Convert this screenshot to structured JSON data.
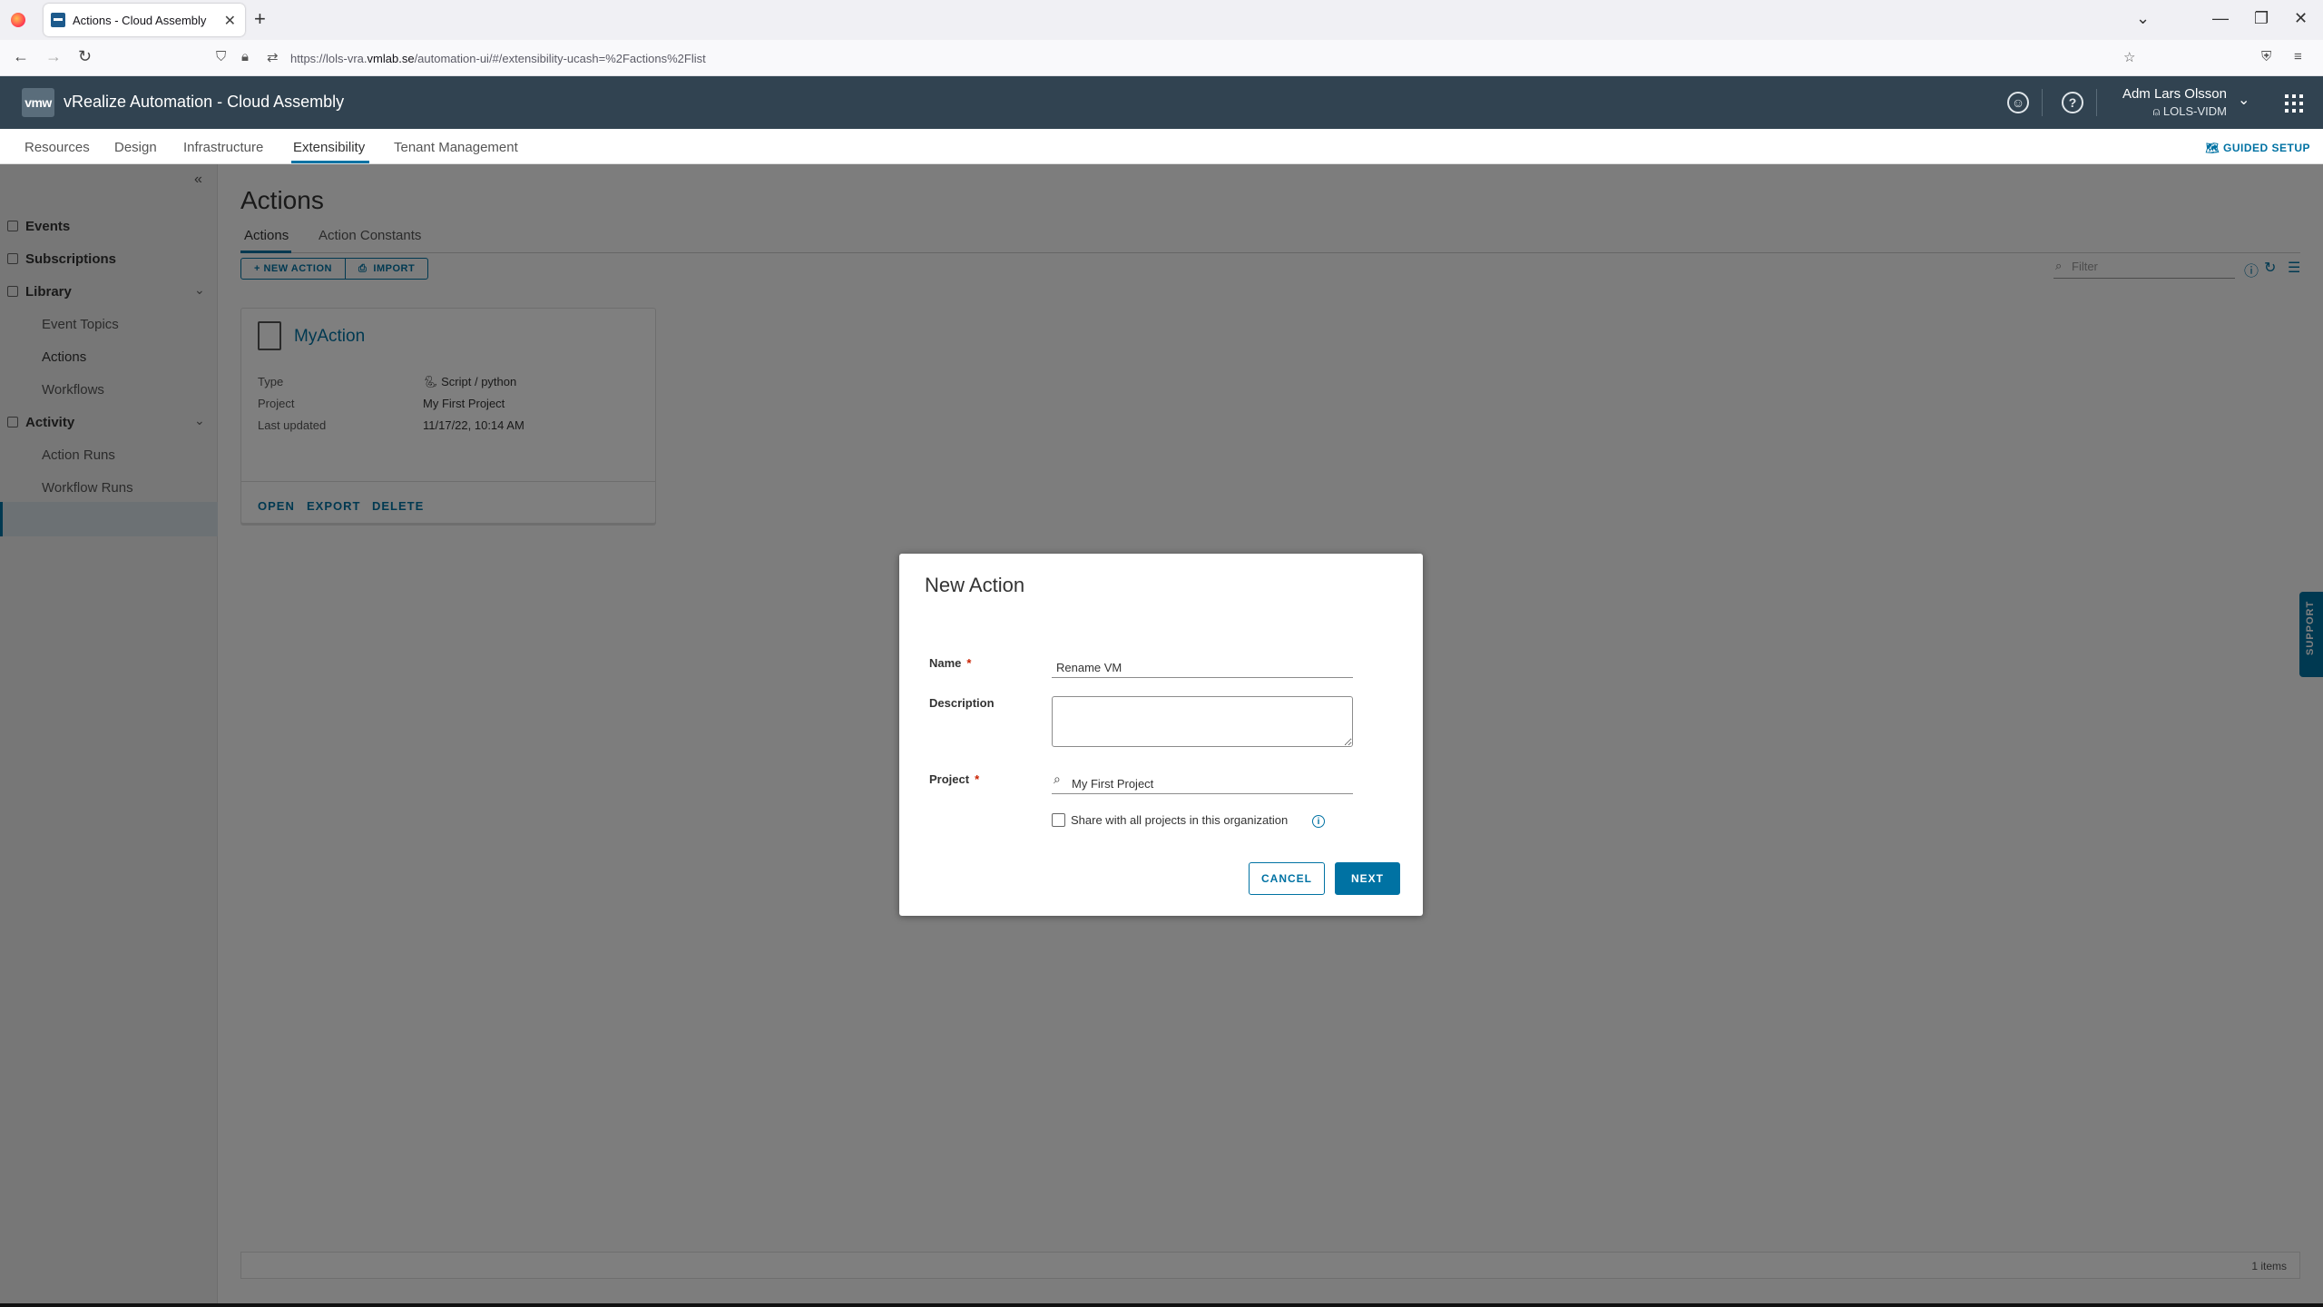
{
  "browser": {
    "tab_title": "Actions - Cloud Assembly",
    "url_prefix": "https://lols-vra.",
    "url_host": "vmlab.se",
    "url_path": "/automation-ui/#/extensibility-ucash=%2Factions%2Flist"
  },
  "header": {
    "logo": "vmw",
    "title": "vRealize Automation - Cloud Assembly",
    "user_name": "Adm Lars Olsson",
    "user_org": "LOLS-VIDM"
  },
  "main_nav": {
    "items": [
      "Resources",
      "Design",
      "Infrastructure",
      "Extensibility",
      "Tenant Management"
    ],
    "active": "Extensibility",
    "guided_setup": "GUIDED SETUP"
  },
  "sidebar": {
    "events": "Events",
    "subscriptions": "Subscriptions",
    "library": "Library",
    "event_topics": "Event Topics",
    "actions": "Actions",
    "workflows": "Workflows",
    "activity": "Activity",
    "action_runs": "Action Runs",
    "workflow_runs": "Workflow Runs"
  },
  "page": {
    "title": "Actions",
    "tabs": [
      "Actions",
      "Action Constants"
    ],
    "new_action": "+ NEW ACTION",
    "import": "IMPORT",
    "filter_placeholder": "Filter",
    "footer_items": "1 items"
  },
  "card": {
    "name": "MyAction",
    "type_label": "Type",
    "type_value": "Script / python",
    "project_label": "Project",
    "project_value": "My First Project",
    "updated_label": "Last updated",
    "updated_value": "11/17/22, 10:14 AM",
    "open": "OPEN",
    "export": "EXPORT",
    "delete": "DELETE"
  },
  "modal": {
    "title": "New Action",
    "name_label": "Name",
    "name_value": "Rename VM",
    "description_label": "Description",
    "description_value": "",
    "project_label": "Project",
    "project_value": "My First Project",
    "share_label": "Share with all projects in this organization",
    "share_checked": false,
    "cancel": "CANCEL",
    "next": "NEXT"
  },
  "support_tab": "SUPPORT",
  "colors": {
    "header_bg": "#314351",
    "accent": "#0072a3",
    "required": "#c92100"
  }
}
